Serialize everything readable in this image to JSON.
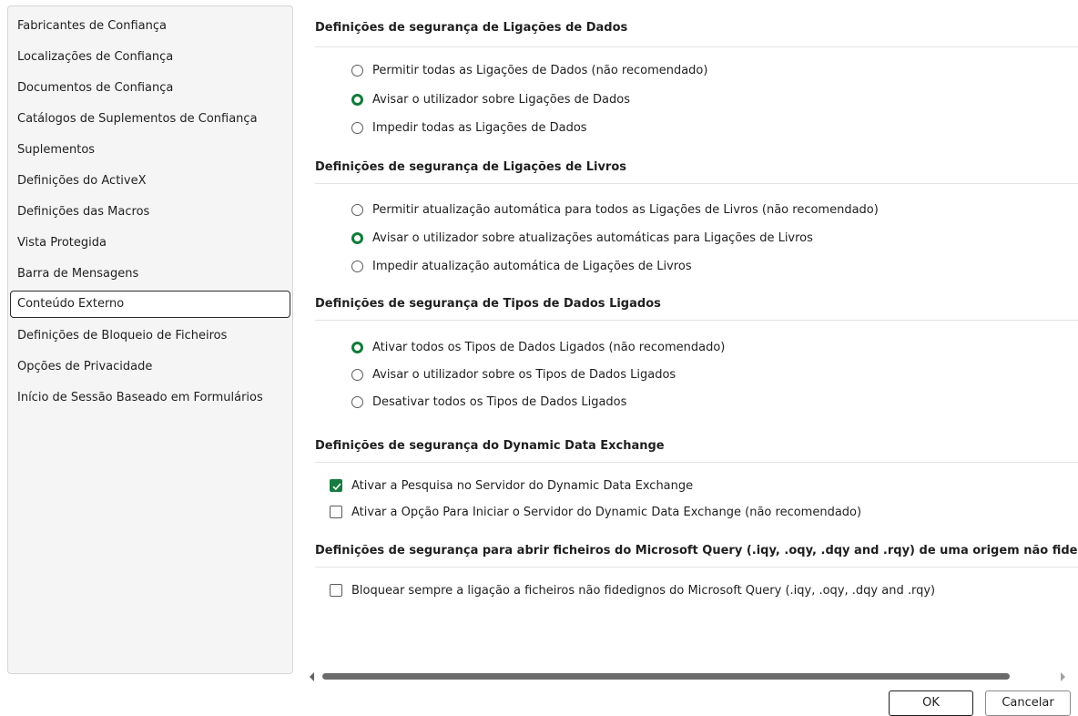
{
  "sidebar": {
    "items": [
      {
        "label": "Fabricantes de Confiança"
      },
      {
        "label": "Localizações de Confiança"
      },
      {
        "label": "Documentos de Confiança"
      },
      {
        "label": "Catálogos de Suplementos de Confiança"
      },
      {
        "label": "Suplementos"
      },
      {
        "label": "Definições do ActiveX"
      },
      {
        "label": "Definições das Macros"
      },
      {
        "label": "Vista Protegida"
      },
      {
        "label": "Barra de Mensagens"
      },
      {
        "label": "Conteúdo Externo",
        "selected": true
      },
      {
        "label": "Definições de Bloqueio de Ficheiros"
      },
      {
        "label": "Opções de Privacidade"
      },
      {
        "label": "Início de Sessão Baseado em Formulários"
      }
    ]
  },
  "sections": {
    "data_connections": {
      "title": "Definições de segurança de Ligações de Dados",
      "options": [
        {
          "label": "Permitir todas as Ligações de Dados (não recomendado)",
          "selected": false
        },
        {
          "label": "Avisar o utilizador sobre Ligações de Dados",
          "selected": true
        },
        {
          "label": "Impedir todas as Ligações de Dados",
          "selected": false
        }
      ]
    },
    "workbook_links": {
      "title": "Definições de segurança de Ligações de Livros",
      "options": [
        {
          "label": "Permitir atualização automática para todos as Ligações de Livros (não recomendado)",
          "selected": false
        },
        {
          "label": "Avisar o utilizador sobre atualizações automáticas para Ligações de Livros",
          "selected": true
        },
        {
          "label": "Impedir atualização automática de Ligações de Livros",
          "selected": false
        }
      ]
    },
    "linked_data_types": {
      "title": "Definições de segurança de Tipos de Dados Ligados",
      "options": [
        {
          "label": "Ativar todos os Tipos de Dados Ligados (não recomendado)",
          "selected": true
        },
        {
          "label": "Avisar o utilizador sobre os Tipos de Dados Ligados",
          "selected": false
        },
        {
          "label": "Desativar todos os Tipos de Dados Ligados",
          "selected": false
        }
      ]
    },
    "dde": {
      "title": "Definições de segurança do Dynamic Data Exchange",
      "checks": [
        {
          "label": "Ativar a Pesquisa no Servidor do Dynamic Data Exchange",
          "checked": true
        },
        {
          "label": "Ativar a Opção Para Iniciar o Servidor do Dynamic Data Exchange (não recomendado)",
          "checked": false
        }
      ]
    },
    "ms_query": {
      "title": "Definições de segurança para abrir ficheiros do Microsoft Query (.iqy, .oqy, .dqy and .rqy) de uma origem não fidedigna",
      "checks": [
        {
          "label": "Bloquear sempre a ligação a ficheiros não fidedignos do Microsoft Query (.iqy, .oqy, .dqy and .rqy)",
          "checked": false
        }
      ]
    }
  },
  "buttons": {
    "ok": "OK",
    "cancel": "Cancelar"
  },
  "colors": {
    "accent": "#167c40",
    "selected_border": "#2b2b2b"
  }
}
